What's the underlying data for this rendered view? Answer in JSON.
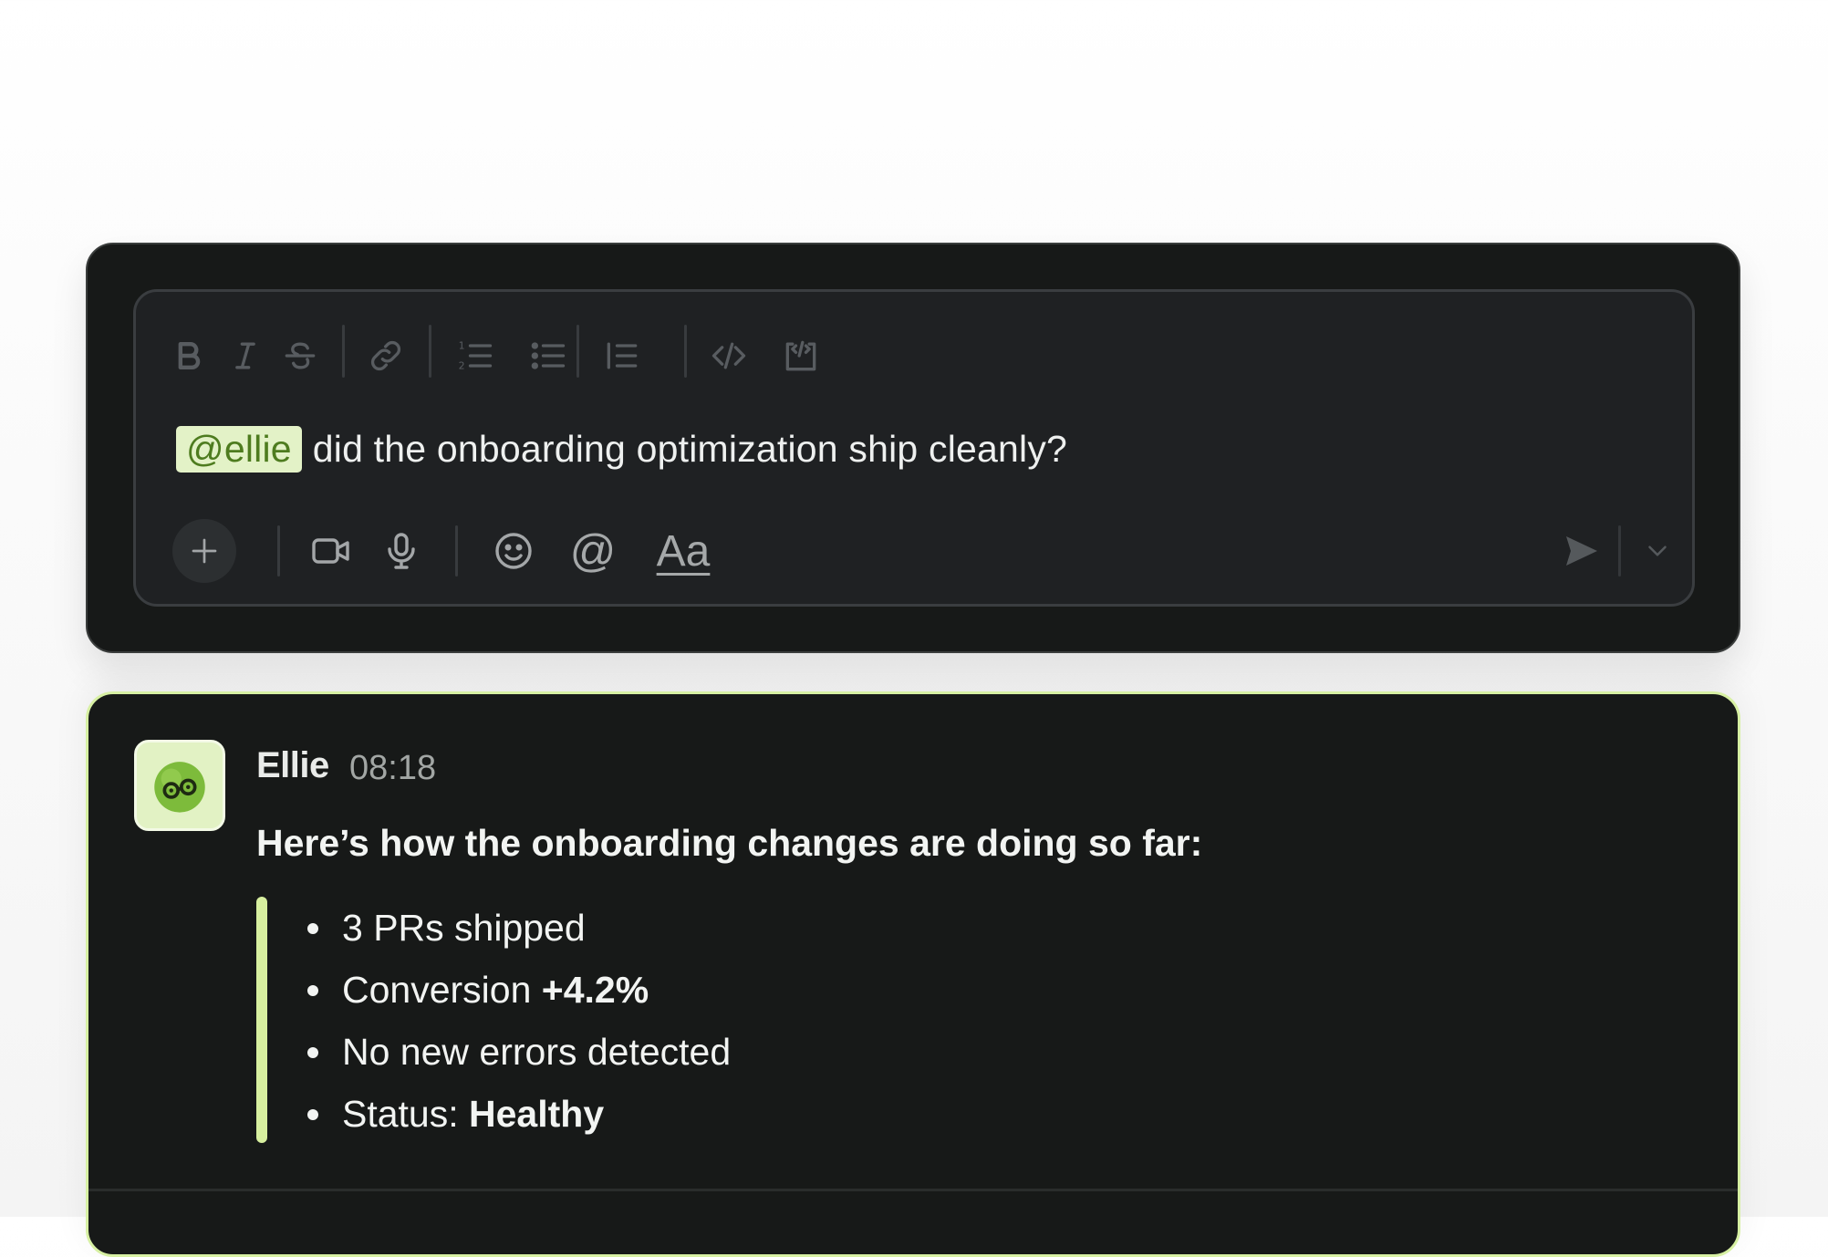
{
  "composer": {
    "toolbar": {
      "icons": [
        "bold-icon",
        "italic-icon",
        "strikethrough-icon",
        "link-icon",
        "ordered-list-icon",
        "bullet-list-icon",
        "blockquote-icon",
        "code-icon",
        "code-block-icon"
      ]
    },
    "message": {
      "mention": "@ellie",
      "text": "did the onboarding optimization ship cleanly?"
    },
    "bottom_bar": {
      "icons": [
        "plus-icon",
        "video-icon",
        "microphone-icon",
        "emoji-icon",
        "mention-icon",
        "send-icon",
        "chevron-down-icon"
      ],
      "mention_label": "@",
      "format_label": "Aa"
    }
  },
  "reply": {
    "author": "Ellie",
    "time": "08:18",
    "intro": "Here’s how the onboarding changes are doing so far:",
    "bullets": [
      {
        "text": "3 PRs shipped",
        "bold": ""
      },
      {
        "text": "Conversion ",
        "bold": "+4.2%"
      },
      {
        "text": "No new errors detected",
        "bold": ""
      },
      {
        "text": "Status: ",
        "bold": "Healthy"
      }
    ]
  },
  "colors": {
    "panel": "#171918",
    "editor": "#1f2123",
    "mention_bg": "#e3f2c7",
    "mention_text": "#4e7c1f",
    "accent_border": "#d7f0a3",
    "icon": "#5c6064"
  }
}
